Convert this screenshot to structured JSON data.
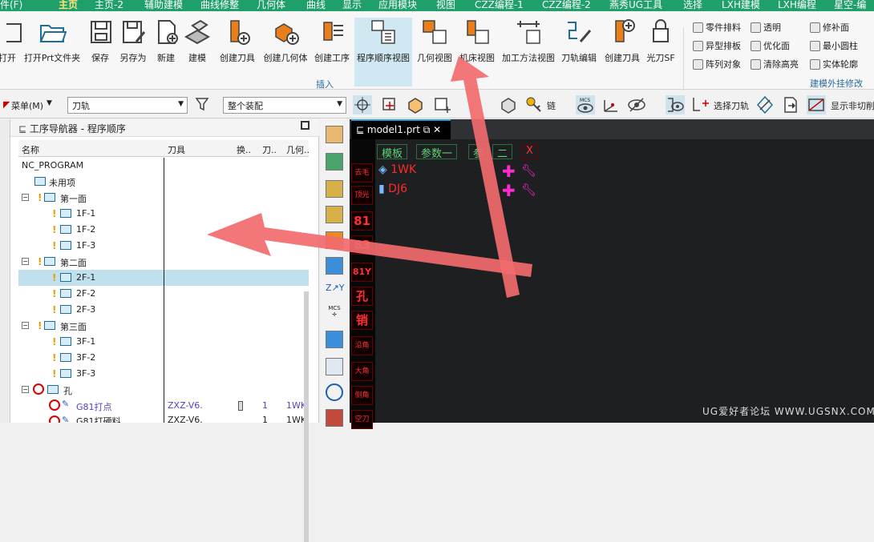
{
  "menu": [
    "件(F)",
    "主页",
    "主页-2",
    "辅助建模",
    "曲线修整",
    "几何体",
    "曲线",
    "显示",
    "应用模块",
    "视图",
    "CZZ编程-1",
    "CZZ编程-2",
    "燕秀UG工具",
    "选择",
    "LXH建模",
    "LXH编程",
    "星空-编"
  ],
  "ribbon": {
    "buttons": [
      "打开",
      "打开Prt文件夹",
      "保存",
      "另存为",
      "新建",
      "建模",
      "创建刀具",
      "创建几何体",
      "创建工序",
      "程序顺序视图",
      "几何视图",
      "机床视图",
      "加工方法视图",
      "刀轨编辑",
      "创建刀具",
      "光刀SF"
    ],
    "insert_label": "插入",
    "small_col1": [
      "零件排料",
      "异型排板",
      "阵列对象"
    ],
    "small_col2": [
      "透明",
      "优化面",
      "清除高亮"
    ],
    "small_col3": [
      "修补面",
      "最小圆柱",
      "实体轮廓"
    ],
    "group_label": "建模外挂修改"
  },
  "toolbar": {
    "menu_label": "菜单(M)",
    "filter_value": "刀轨",
    "assembly_value": "整个装配",
    "chain_label": "链",
    "select_toolpath": "选择刀轨",
    "show_nonclip": "显示非切削",
    "mcs_label": "MCS"
  },
  "navigator": {
    "title": "工序导航器 - 程序顺序",
    "columns": [
      "名称",
      "刀具",
      "换..",
      "刀..",
      "几何.."
    ],
    "rows": [
      {
        "name": "NC_PROGRAM",
        "level": 0
      },
      {
        "name": "未用项",
        "level": 1
      },
      {
        "name": "第一面",
        "level": 1
      },
      {
        "name": "1F-1",
        "level": 2
      },
      {
        "name": "1F-2",
        "level": 2
      },
      {
        "name": "1F-3",
        "level": 2
      },
      {
        "name": "第二面",
        "level": 1
      },
      {
        "name": "2F-1",
        "level": 2
      },
      {
        "name": "2F-2",
        "level": 2
      },
      {
        "name": "2F-3",
        "level": 2
      },
      {
        "name": "第三面",
        "level": 1
      },
      {
        "name": "3F-1",
        "level": 2
      },
      {
        "name": "3F-2",
        "level": 2
      },
      {
        "name": "3F-3",
        "level": 2
      },
      {
        "name": "孔",
        "level": 1
      },
      {
        "name": "G81打点",
        "level": 2,
        "tool": "ZXZ-V6.",
        "t": "1",
        "geom": "1WK"
      },
      {
        "name": "G81打硬料",
        "level": 2,
        "tool": "ZXZ-V6.",
        "t": "1",
        "geom": "1WK"
      }
    ]
  },
  "vtools": {
    "mcs": "MCS"
  },
  "graphic": {
    "tab_title": "model1.prt",
    "top_buttons": [
      "模板",
      "参数一",
      "参",
      "二",
      "X"
    ],
    "items": [
      "1WK",
      "DJ6"
    ],
    "side_boxes": [
      "去毛",
      "顶光",
      "81",
      "83",
      "81Y",
      "孔",
      "销",
      "沿角",
      "大角",
      "侧角",
      "空刀"
    ]
  },
  "watermark": "UG爱好者论坛 WWW.UGSNX.COM"
}
